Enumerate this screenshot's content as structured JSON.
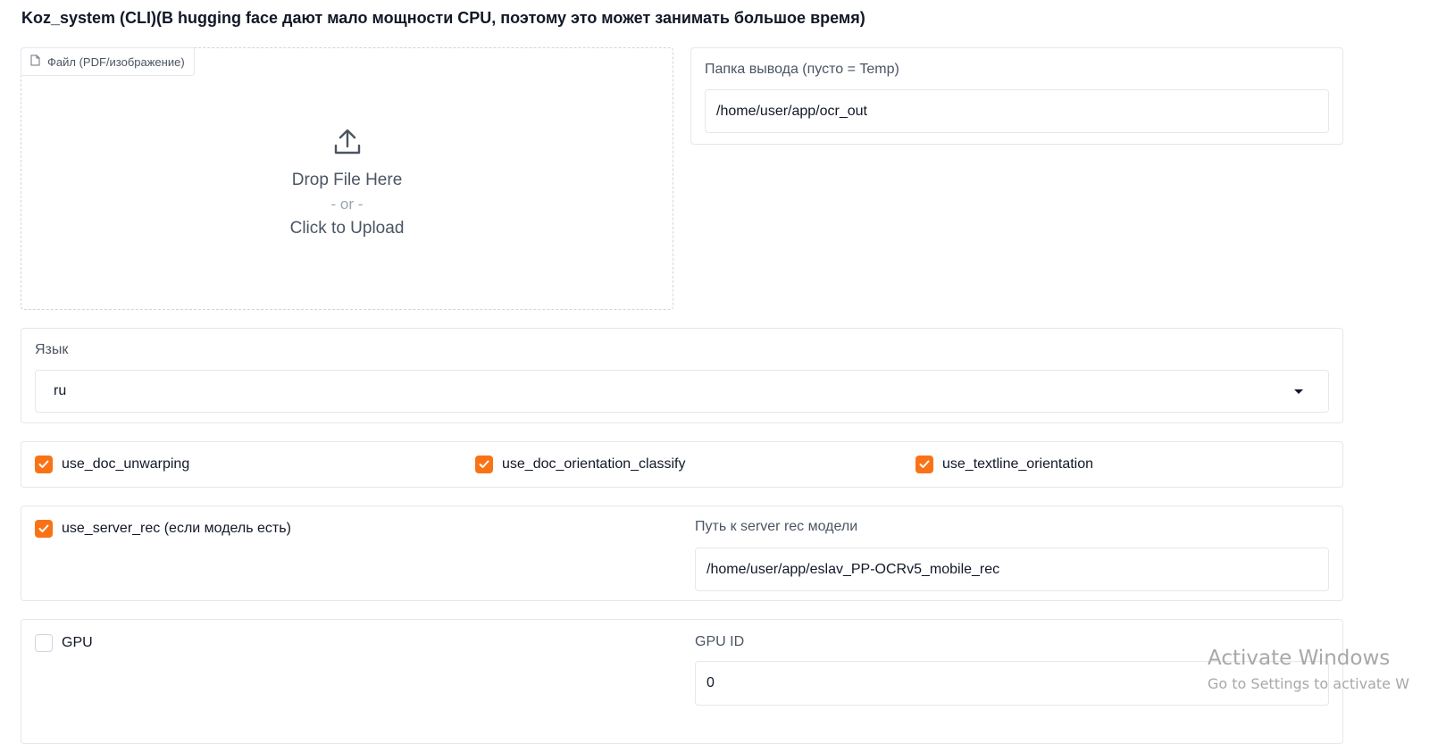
{
  "app_title": "Koz_system (CLI)(В hugging face дают мало мощности CPU, поэтому это может занимать большое время)",
  "file_upload": {
    "label": "Файл (PDF/изображение)",
    "drop_text": "Drop File Here",
    "or_text": "- or -",
    "click_text": "Click to Upload",
    "icons": [
      "file-icon",
      "upload-icon"
    ]
  },
  "output_folder": {
    "label": "Папка вывода (пусто = Temp)",
    "value": "/home/user/app/ocr_out"
  },
  "language": {
    "label": "Язык",
    "selected": "ru"
  },
  "options": [
    {
      "label": "use_doc_unwarping",
      "checked": true
    },
    {
      "label": "use_doc_orientation_classify",
      "checked": true
    },
    {
      "label": "use_textline_orientation",
      "checked": true
    }
  ],
  "server_rec": {
    "checkbox_label": "use_server_rec (если модель есть)",
    "checked": true,
    "path_label": "Путь к server rec модели",
    "path_value": "/home/user/app/eslav_PP-OCRv5_mobile_rec"
  },
  "gpu": {
    "checkbox_label": "GPU",
    "checked": false,
    "id_label": "GPU ID",
    "id_value": "0"
  },
  "watermark": {
    "line1": "Activate Windows",
    "line2": "Go to Settings to activate W"
  },
  "colors": {
    "accent": "#f97316",
    "border": "#e5e7eb",
    "text": "#111827",
    "muted": "#4b5563"
  }
}
